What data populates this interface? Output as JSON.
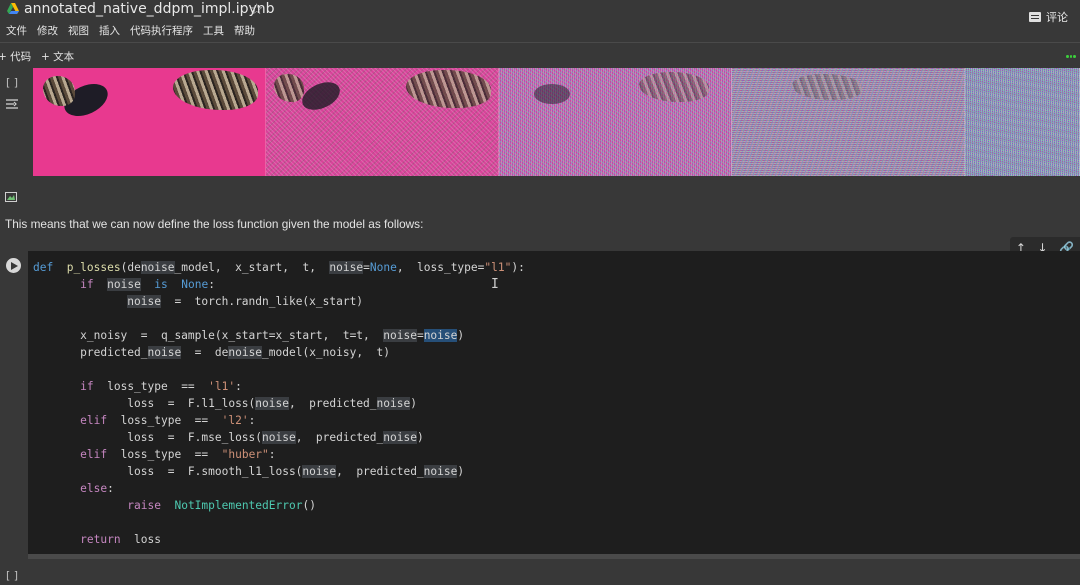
{
  "header": {
    "notebook_title": "annotated_native_ddpm_impl.ipynb",
    "star_icon": "star-icon",
    "comment_label": "评论"
  },
  "menu": [
    "文件",
    "修改",
    "视图",
    "插入",
    "代码执行程序",
    "工具",
    "帮助"
  ],
  "toolbar": {
    "add_code": "+ 代码",
    "add_text": "+ 文本"
  },
  "output_cell": {
    "run_indicator": "[ ]"
  },
  "markdown_cell": {
    "text": "This means that we can now define the loss function given the model as follows:"
  },
  "next_cell": {
    "run_indicator": "[ ]"
  },
  "colors": {
    "background": "#383838",
    "code_background": "#1e1e1e",
    "keyword": "#c586c0",
    "string": "#ce9178",
    "builtin_class": "#4ec9b0"
  }
}
